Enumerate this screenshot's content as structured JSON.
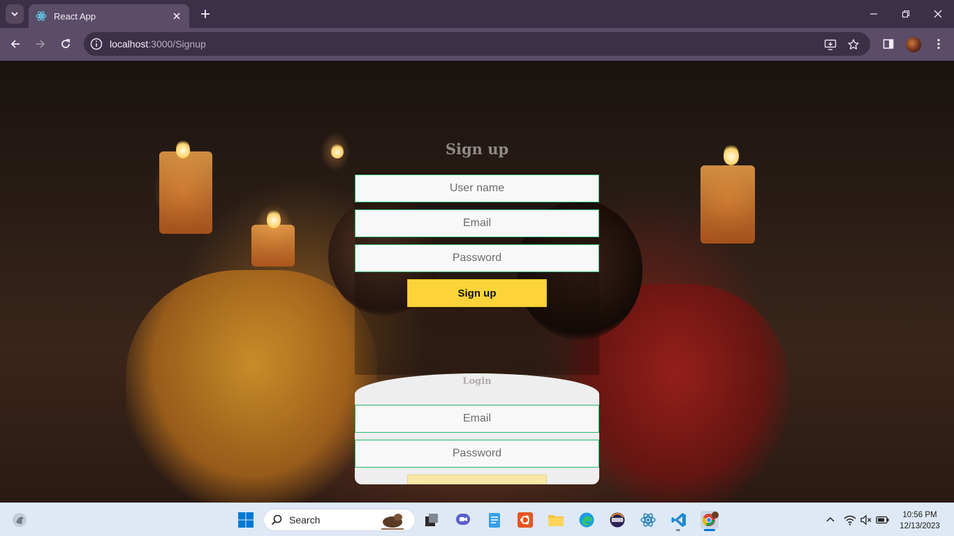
{
  "browser": {
    "tab_title": "React App",
    "url_host": "localhost",
    "url_path": ":3000/Signup"
  },
  "page": {
    "signup": {
      "title": "Sign up",
      "username_placeholder": "User name",
      "email_placeholder": "Email",
      "password_placeholder": "Password",
      "button_label": "Sign up"
    },
    "login": {
      "title": "Login",
      "email_placeholder": "Email",
      "password_placeholder": "Password"
    }
  },
  "taskbar": {
    "search_placeholder": "Search",
    "time": "10:56 PM",
    "date": "12/13/2023"
  },
  "colors": {
    "browser_frame": "#3c3048",
    "toolbar": "#5b4d68",
    "field_border": "#29b56a",
    "signup_button": "#fcd43a",
    "login_button": "#f9e7a8"
  }
}
